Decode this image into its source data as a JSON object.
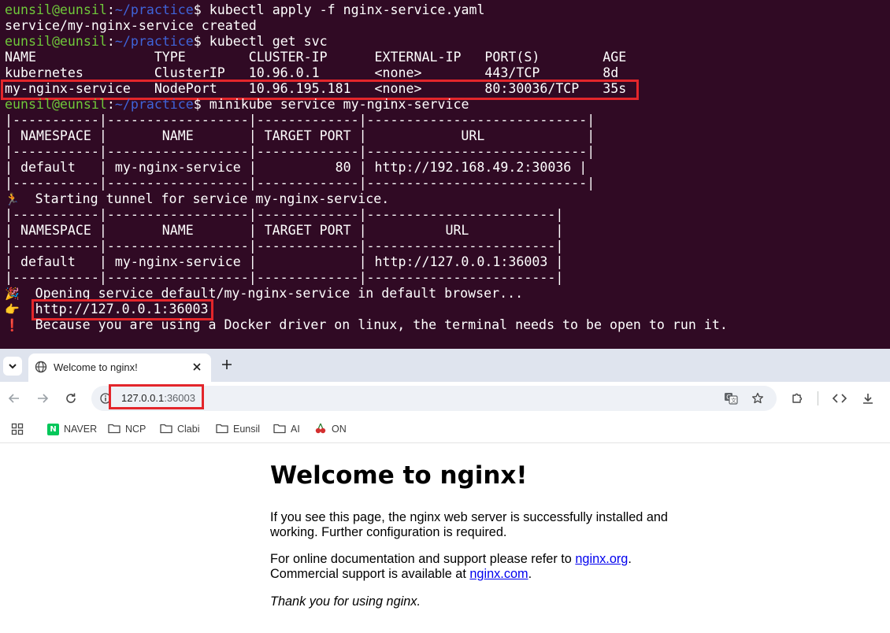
{
  "terminal": {
    "prompt": {
      "user": "eunsil@eunsil",
      "sep": ":",
      "path": "~/practice",
      "dollar": "$"
    },
    "cmd_apply": "kubectl apply -f nginx-service.yaml",
    "out_created": "service/my-nginx-service created",
    "cmd_get_svc": "kubectl get svc",
    "svc_header": "NAME               TYPE        CLUSTER-IP      EXTERNAL-IP   PORT(S)        AGE",
    "svc_row_kubernetes": "kubernetes         ClusterIP   10.96.0.1       <none>        443/TCP        8d",
    "svc_row_nginx": "my-nginx-service   NodePort    10.96.195.181   <none>        80:30036/TCP   35s",
    "cmd_minikube": "minikube service my-nginx-service",
    "table1": {
      "border_top": "|-----------|------------------|-------------|----------------------------|",
      "header": "| NAMESPACE |       NAME       | TARGET PORT |            URL             |",
      "border_mid": "|-----------|------------------|-------------|----------------------------|",
      "row": "| default   | my-nginx-service |          80 | http://192.168.49.2:30036 |",
      "border_bot": "|-----------|------------------|-------------|----------------------------|"
    },
    "tunnel_emoji": "🏃",
    "tunnel_text": "Starting tunnel for service my-nginx-service.",
    "table2": {
      "border_top": "|-----------|------------------|-------------|------------------------|",
      "header": "| NAMESPACE |       NAME       | TARGET PORT |          URL           |",
      "border_mid": "|-----------|------------------|-------------|------------------------|",
      "row": "| default   | my-nginx-service |             | http://127.0.0.1:36003 |",
      "border_bot": "|-----------|------------------|-------------|------------------------|"
    },
    "opening_emoji": "🎉",
    "opening_text": "Opening service default/my-nginx-service in default browser...",
    "pointer_emoji": "👉",
    "tunnel_url": "http://127.0.0.1:36003",
    "warn_emoji": "❗",
    "warn_text": "Because you are using a Docker driver on linux, the terminal needs to be open to run it."
  },
  "browser": {
    "tab_title": "Welcome to nginx!",
    "url_host": "127.0.0.1",
    "url_port": ":36003",
    "bookmarks": [
      "NAVER",
      "NCP",
      "Clabi",
      "Eunsil",
      "AI",
      "ON"
    ],
    "icons": {
      "tab_search": "chevron-down-icon",
      "tab_close": "close-icon",
      "new_tab": "plus-icon",
      "back": "back-arrow-icon",
      "forward": "forward-arrow-icon",
      "reload": "reload-icon",
      "site_info": "info-icon",
      "translate": "translate-icon",
      "bookmark_star": "star-icon",
      "extensions": "puzzle-icon",
      "devtools": "code-icon",
      "download": "download-icon",
      "apps": "apps-grid-icon",
      "folder": "folder-icon",
      "naver": "naver-logo-icon",
      "cherry": "cherry-icon"
    }
  },
  "page": {
    "heading": "Welcome to nginx!",
    "p1_line1": "If you see this page, the nginx web server is successfully installed and",
    "p1_line2": "working. Further configuration is required.",
    "p2_prefix": "For online documentation and support please refer to ",
    "p2_link": "nginx.org",
    "p2_suffix": ".",
    "p3_prefix": "Commercial support is available at ",
    "p3_link": "nginx.com",
    "p3_suffix": ".",
    "thanks": "Thank you for using nginx."
  },
  "colors": {
    "terminal_bg": "#300a24",
    "prompt_user": "#6fc83a",
    "prompt_path": "#3f63d8",
    "highlight_box": "#e3262b",
    "link": "#0000ee"
  }
}
